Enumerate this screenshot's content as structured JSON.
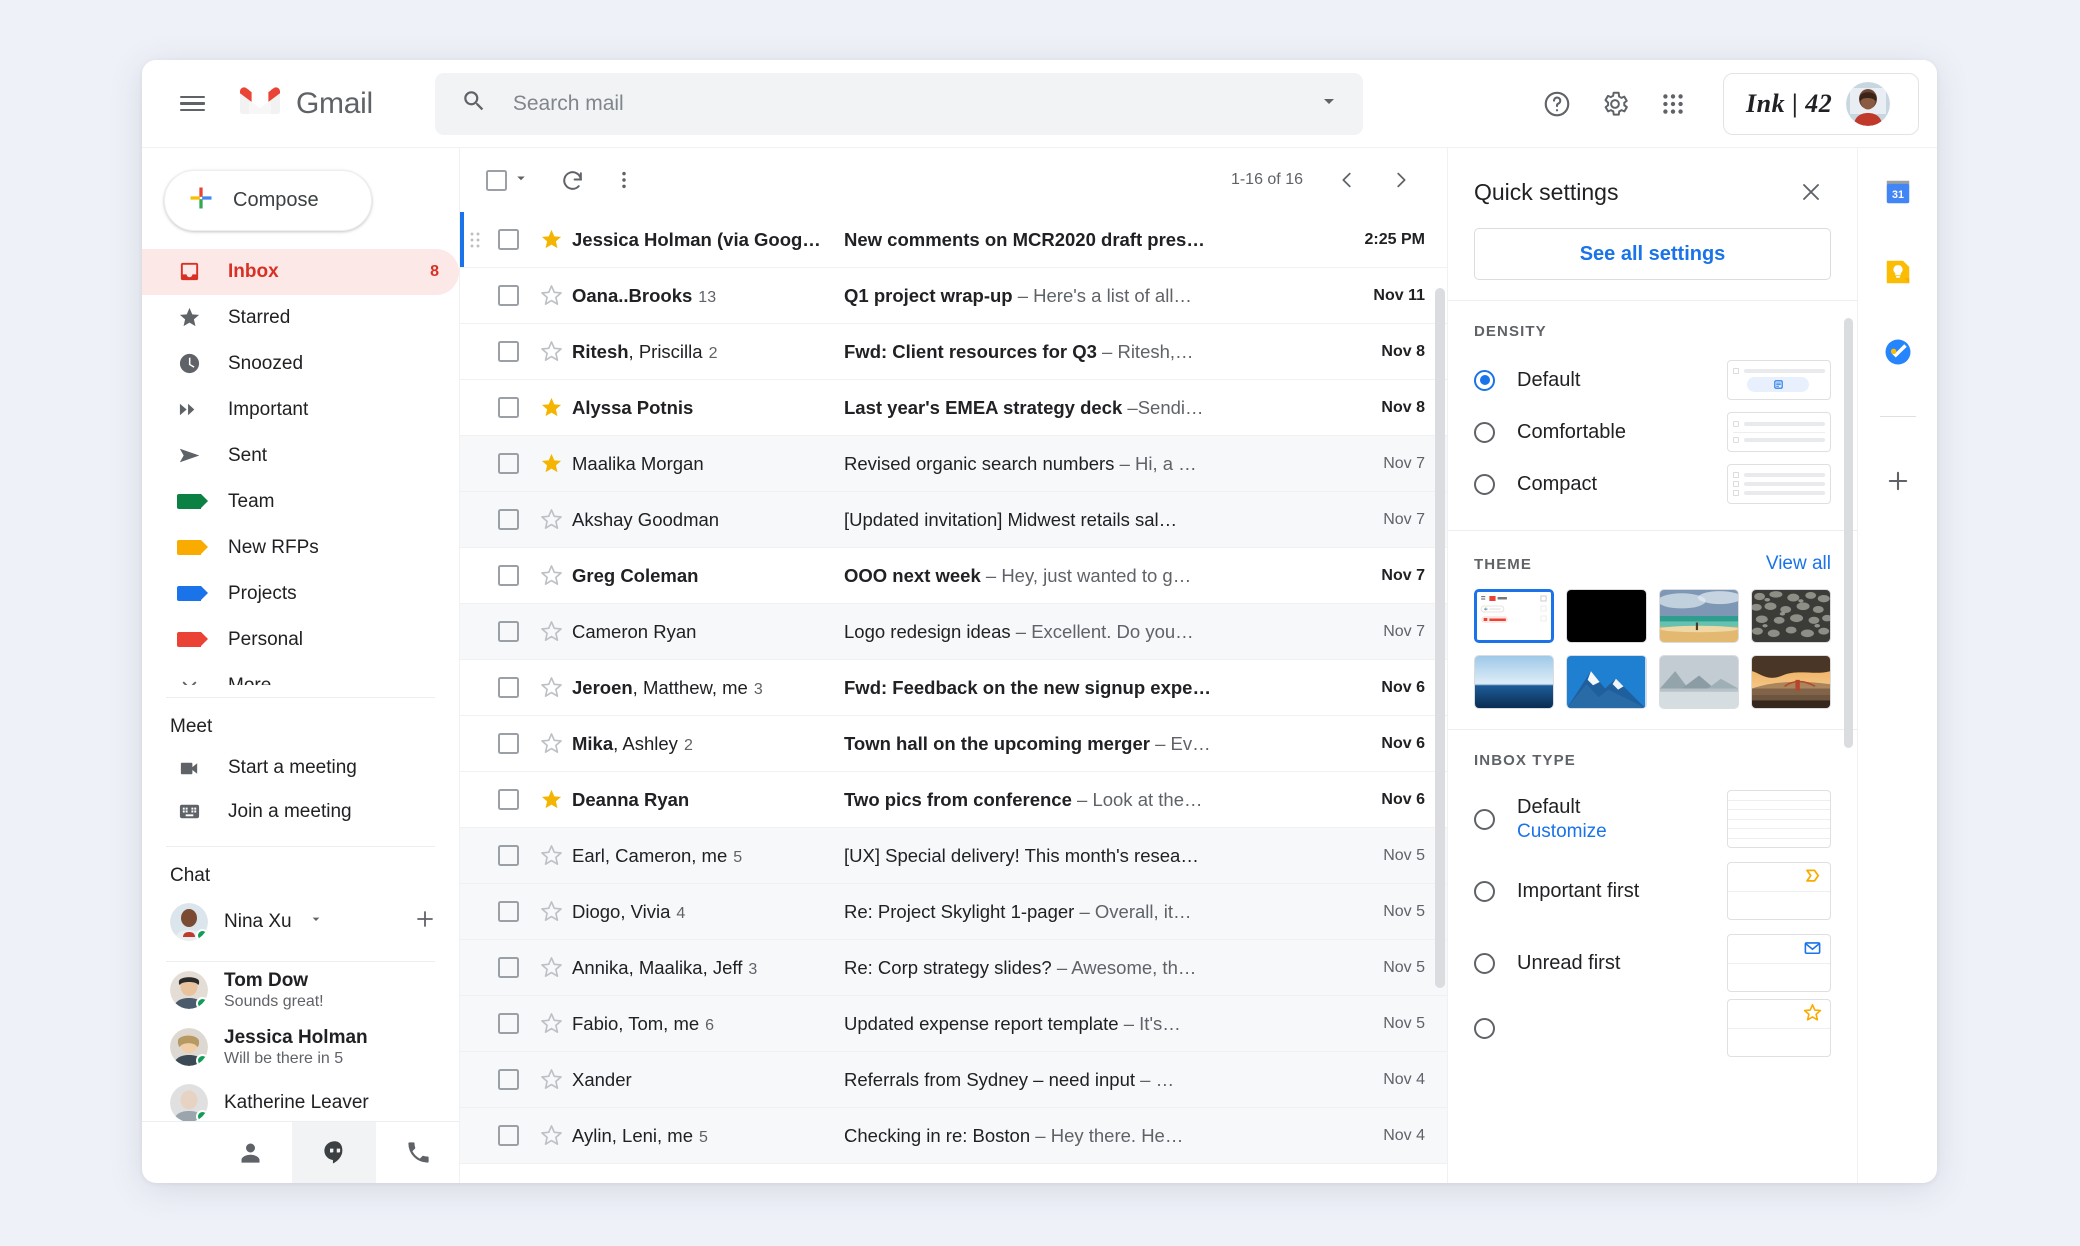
{
  "app": {
    "brand": "Gmail",
    "menu_icon": "hamburger-icon",
    "logo_icon": "gmail-logo-icon"
  },
  "search": {
    "placeholder": "Search mail",
    "value": "",
    "search_icon": "search-icon",
    "options_icon": "chevron-down-icon"
  },
  "topbar": {
    "help_icon": "help-icon",
    "settings_icon": "gear-icon",
    "apps_icon": "apps-grid-icon",
    "account_label": "Ink | 42",
    "avatar_icon": "avatar"
  },
  "sidebar": {
    "compose_label": "Compose",
    "compose_icon": "plus-icon",
    "items": [
      {
        "label": "Inbox",
        "icon": "inbox-icon",
        "count": "8",
        "active": true,
        "color": "#d93025"
      },
      {
        "label": "Starred",
        "icon": "star-icon",
        "count": "",
        "active": false,
        "color": "#5f6368"
      },
      {
        "label": "Snoozed",
        "icon": "clock-icon",
        "count": "",
        "active": false,
        "color": "#5f6368"
      },
      {
        "label": "Important",
        "icon": "important-icon",
        "count": "",
        "active": false,
        "color": "#5f6368"
      },
      {
        "label": "Sent",
        "icon": "send-icon",
        "count": "",
        "active": false,
        "color": "#5f6368"
      },
      {
        "label": "Team",
        "icon": "label-tag-icon",
        "count": "",
        "active": false,
        "color": "#0b8043"
      },
      {
        "label": "New RFPs",
        "icon": "label-tag-icon",
        "count": "",
        "active": false,
        "color": "#f9ab00"
      },
      {
        "label": "Projects",
        "icon": "label-tag-icon",
        "count": "",
        "active": false,
        "color": "#1a73e8"
      },
      {
        "label": "Personal",
        "icon": "label-tag-icon",
        "count": "",
        "active": false,
        "color": "#ea4335"
      },
      {
        "label": "More",
        "icon": "chevron-down-icon",
        "count": "",
        "active": false,
        "color": "#5f6368"
      }
    ],
    "meet": {
      "title": "Meet",
      "items": [
        {
          "label": "Start a meeting",
          "icon": "video-camera-icon"
        },
        {
          "label": "Join a meeting",
          "icon": "keyboard-icon"
        }
      ]
    },
    "chat": {
      "title": "Chat",
      "me": {
        "name": "Nina Xu",
        "dropdown_icon": "caret-down-icon",
        "add_icon": "plus-icon",
        "status": "online"
      },
      "contacts": [
        {
          "name": "Tom Dow",
          "snippet": "Sounds great!",
          "status": "online"
        },
        {
          "name": "Jessica Holman",
          "snippet": "Will be there in 5",
          "status": "online"
        },
        {
          "name": "Katherine Leaver",
          "snippet": "",
          "status": "online"
        }
      ],
      "bottom_nav": [
        {
          "icon": "person-icon",
          "selected": false
        },
        {
          "icon": "hangouts-icon",
          "selected": true
        },
        {
          "icon": "phone-icon",
          "selected": false
        }
      ]
    }
  },
  "maillist": {
    "toolbar": {
      "select_all_icon": "checkbox-icon",
      "select_dropdown_icon": "caret-down-icon",
      "refresh_icon": "refresh-icon",
      "more_icon": "more-vertical-icon",
      "range": "1-16 of 16",
      "prev_icon": "chevron-left-icon",
      "next_icon": "chevron-right-icon"
    },
    "rows": [
      {
        "sender": "Jessica Holman (via Goog…",
        "count": "",
        "subject": "New comments on MCR2020 draft pres…",
        "snippet": "",
        "date": "2:25 PM",
        "unread": true,
        "starred": true,
        "read_bg": false,
        "selected": true
      },
      {
        "sender": "Oana..Brooks",
        "count": "13",
        "subject": "Q1 project wrap-up",
        "snippet": " – Here's a list of all…",
        "date": "Nov 11",
        "unread": true,
        "starred": false,
        "read_bg": false,
        "selected": false
      },
      {
        "sender": "Ritesh, Priscilla",
        "count": "2",
        "subject": "Fwd: Client resources for Q3",
        "snippet": " – Ritesh,…",
        "date": "Nov 8",
        "unread": true,
        "starred": false,
        "read_bg": false,
        "selected": false
      },
      {
        "sender": "Alyssa Potnis",
        "count": "",
        "subject": "Last year's EMEA strategy deck",
        "snippet": " –Sendi…",
        "date": "Nov 8",
        "unread": true,
        "starred": true,
        "read_bg": false,
        "selected": false
      },
      {
        "sender": "Maalika Morgan",
        "count": "",
        "subject": "Revised organic search numbers",
        "snippet": " – Hi, a …",
        "date": "Nov 7",
        "unread": false,
        "starred": true,
        "read_bg": true,
        "selected": false
      },
      {
        "sender": "Akshay Goodman",
        "count": "",
        "subject": "[Updated invitation] Midwest retails sal…",
        "snippet": "",
        "date": "Nov 7",
        "unread": false,
        "starred": false,
        "read_bg": true,
        "selected": false
      },
      {
        "sender": "Greg Coleman",
        "count": "",
        "subject": "OOO next week",
        "snippet": " – Hey, just wanted to g…",
        "date": "Nov 7",
        "unread": true,
        "starred": false,
        "read_bg": false,
        "selected": false
      },
      {
        "sender": "Cameron Ryan",
        "count": "",
        "subject": "Logo redesign ideas",
        "snippet": " – Excellent. Do you…",
        "date": "Nov 7",
        "unread": false,
        "starred": false,
        "read_bg": true,
        "selected": false
      },
      {
        "sender": "Jeroen, Matthew, me",
        "count": "3",
        "subject": "Fwd: Feedback on the new signup expe…",
        "snippet": "",
        "date": "Nov 6",
        "unread": true,
        "starred": false,
        "read_bg": false,
        "selected": false
      },
      {
        "sender": "Mika, Ashley",
        "count": "2",
        "subject": "Town hall on the upcoming merger",
        "snippet": " – Ev…",
        "date": "Nov 6",
        "unread": true,
        "starred": false,
        "read_bg": false,
        "selected": false
      },
      {
        "sender": "Deanna Ryan",
        "count": "",
        "subject": "Two pics from conference",
        "snippet": " – Look at the…",
        "date": "Nov 6",
        "unread": true,
        "starred": true,
        "read_bg": false,
        "selected": false
      },
      {
        "sender": "Earl, Cameron, me",
        "count": "5",
        "subject": "[UX] Special delivery! This month's resea…",
        "snippet": "",
        "date": "Nov 5",
        "unread": false,
        "starred": false,
        "read_bg": true,
        "selected": false
      },
      {
        "sender": "Diogo, Vivia",
        "count": "4",
        "subject": "Re: Project Skylight 1-pager",
        "snippet": " – Overall, it…",
        "date": "Nov 5",
        "unread": false,
        "starred": false,
        "read_bg": true,
        "selected": false
      },
      {
        "sender": "Annika, Maalika, Jeff",
        "count": "3",
        "subject": "Re: Corp strategy slides?",
        "snippet": " – Awesome, th…",
        "date": "Nov 5",
        "unread": false,
        "starred": false,
        "read_bg": true,
        "selected": false
      },
      {
        "sender": "Fabio, Tom, me",
        "count": "6",
        "subject": "Updated expense report template",
        "snippet": " – It's…",
        "date": "Nov 5",
        "unread": false,
        "starred": false,
        "read_bg": true,
        "selected": false
      },
      {
        "sender": "Xander",
        "count": "",
        "subject": "Referrals from Sydney – need input",
        "snippet": " – …",
        "date": "Nov 4",
        "unread": false,
        "starred": false,
        "read_bg": true,
        "selected": false
      },
      {
        "sender": "Aylin, Leni, me",
        "count": "5",
        "subject": "Checking in re: Boston",
        "snippet": " – Hey there. He…",
        "date": "Nov 4",
        "unread": false,
        "starred": false,
        "read_bg": true,
        "selected": false
      }
    ]
  },
  "quick_settings": {
    "title": "Quick settings",
    "close_icon": "close-icon",
    "see_all_label": "See all settings",
    "density": {
      "title": "DENSITY",
      "options": [
        {
          "label": "Default",
          "selected": true
        },
        {
          "label": "Comfortable",
          "selected": false
        },
        {
          "label": "Compact",
          "selected": false
        }
      ]
    },
    "theme": {
      "title": "THEME",
      "view_all_label": "View all",
      "thumbs": [
        {
          "name": "light-gmail-theme",
          "selected": true
        },
        {
          "name": "dark-theme",
          "selected": false
        },
        {
          "name": "beach-theme",
          "selected": false
        },
        {
          "name": "pebbles-theme",
          "selected": false
        },
        {
          "name": "ocean-theme",
          "selected": false
        },
        {
          "name": "mountain-theme",
          "selected": false
        },
        {
          "name": "fjord-theme",
          "selected": false
        },
        {
          "name": "sunset-bridge-theme",
          "selected": false
        }
      ]
    },
    "inbox_type": {
      "title": "INBOX TYPE",
      "options": [
        {
          "label": "Default",
          "link": "Customize",
          "selected": false,
          "badge": "lines"
        },
        {
          "label": "Important first",
          "link": "",
          "selected": false,
          "badge": "important"
        },
        {
          "label": "Unread first",
          "link": "",
          "selected": false,
          "badge": "envelope"
        },
        {
          "label": "",
          "link": "",
          "selected": false,
          "badge": "star"
        }
      ]
    }
  },
  "rail": {
    "items": [
      {
        "icon": "calendar-icon",
        "label": "31"
      },
      {
        "icon": "keep-icon",
        "label": ""
      },
      {
        "icon": "tasks-icon",
        "label": ""
      }
    ],
    "add_icon": "plus-icon"
  }
}
